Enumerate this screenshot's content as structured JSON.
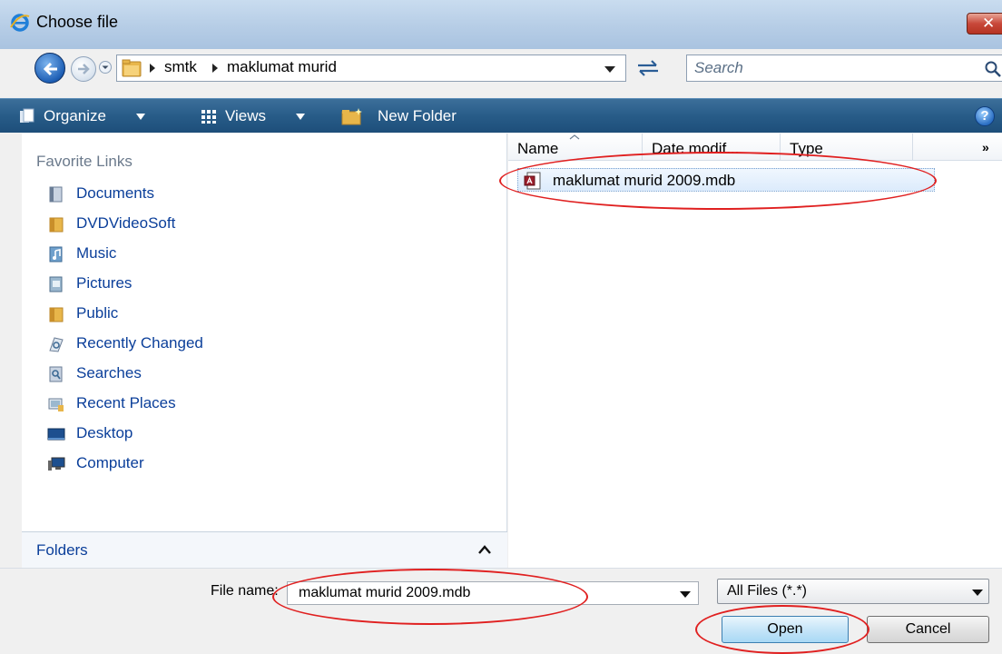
{
  "window": {
    "title": "Choose file",
    "close_glyph": "✕",
    "title_icon": "ie-logo-icon"
  },
  "navigation": {
    "breadcrumbs": [
      "smtk",
      "maklumat murid"
    ],
    "search_placeholder": "Search"
  },
  "toolbar": {
    "organize_label": "Organize",
    "views_label": "Views",
    "new_folder_label": "New Folder",
    "help_glyph": "?"
  },
  "favorites": {
    "title": "Favorite Links",
    "items": [
      {
        "label": "Documents",
        "icon": "documents-icon"
      },
      {
        "label": "DVDVideoSoft",
        "icon": "folder-icon"
      },
      {
        "label": "Music",
        "icon": "music-icon"
      },
      {
        "label": "Pictures",
        "icon": "pictures-icon"
      },
      {
        "label": "Public",
        "icon": "folder-icon"
      },
      {
        "label": "Recently Changed",
        "icon": "recently-changed-icon"
      },
      {
        "label": "Searches",
        "icon": "searches-icon"
      },
      {
        "label": "Recent Places",
        "icon": "recent-places-icon"
      },
      {
        "label": "Desktop",
        "icon": "desktop-icon"
      },
      {
        "label": "Computer",
        "icon": "computer-icon"
      }
    ],
    "folders_label": "Folders"
  },
  "file_list": {
    "columns": [
      "Name",
      "Date modif...",
      "Type"
    ],
    "more_glyph": "»",
    "files": [
      {
        "name": "maklumat murid 2009.mdb",
        "icon": "access-db-icon"
      }
    ]
  },
  "footer": {
    "file_name_label": "File name:",
    "file_name_value": "maklumat murid 2009.mdb",
    "file_type_value": "All Files (*.*)",
    "open_label": "Open",
    "cancel_label": "Cancel"
  },
  "colors": {
    "toolbar": "#285c88",
    "link": "#0b3f9a",
    "annotation": "#e02020"
  }
}
